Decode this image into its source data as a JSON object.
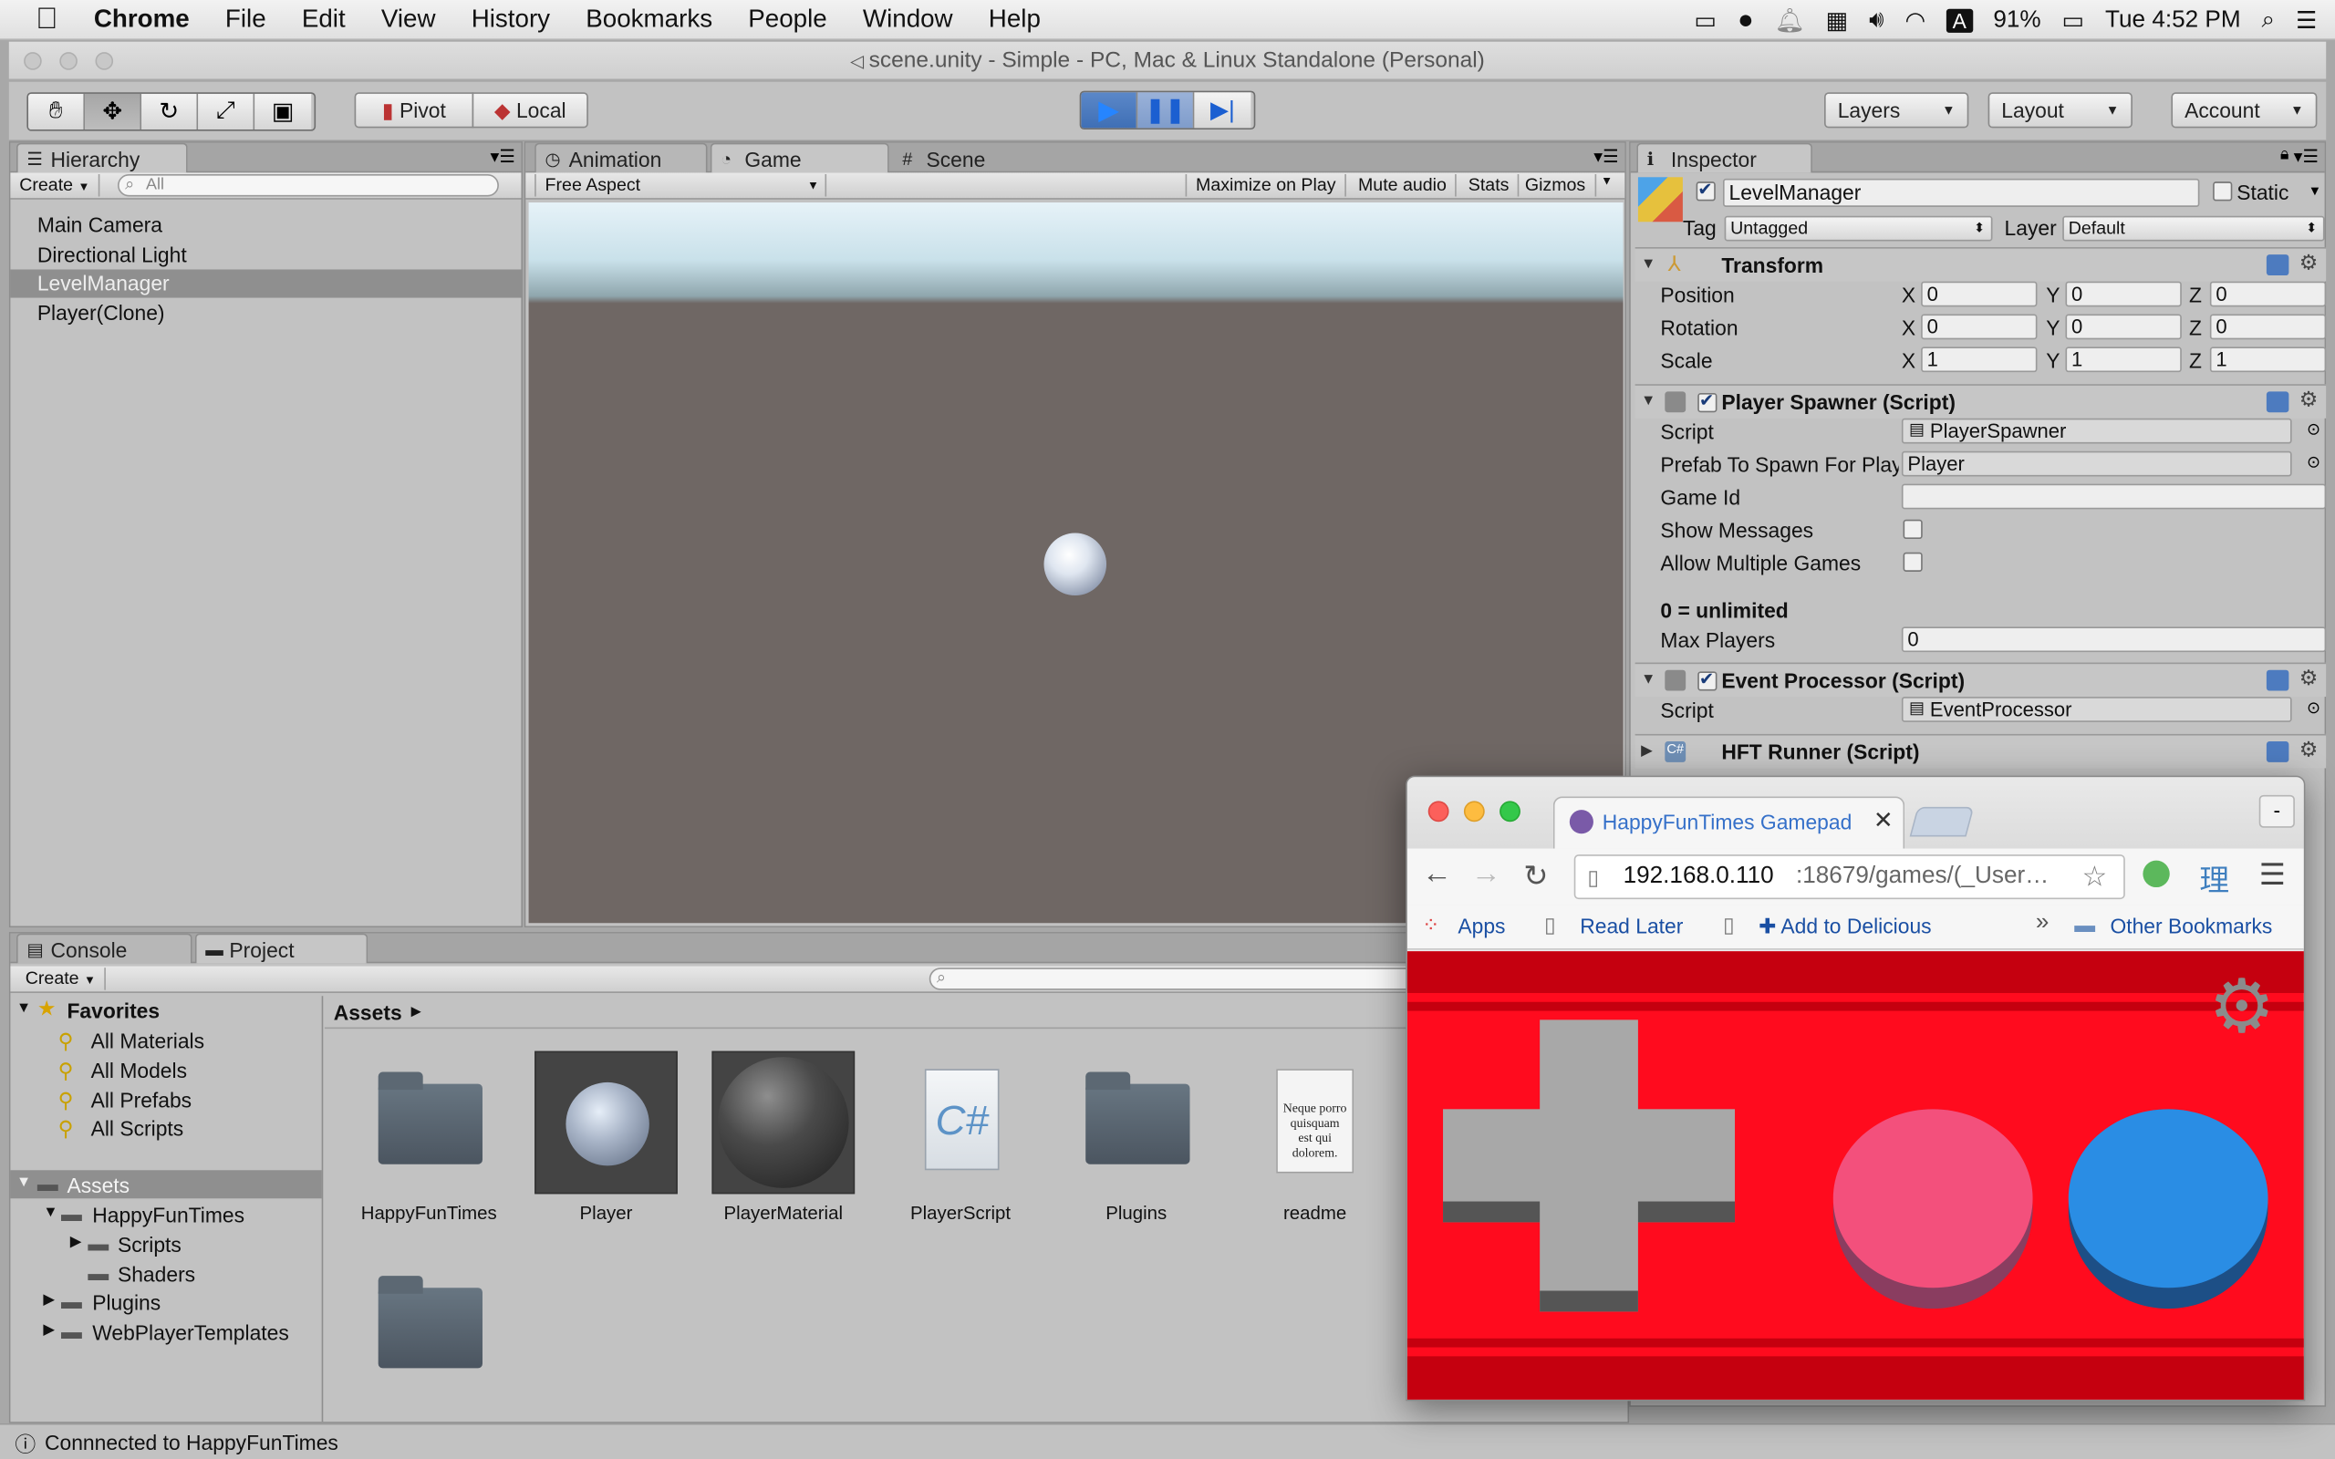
{
  "menubar": {
    "apple": "",
    "app": "Chrome",
    "items": [
      "File",
      "Edit",
      "View",
      "History",
      "Bookmarks",
      "People",
      "Window",
      "Help"
    ],
    "battery": "91%",
    "clock": "Tue 4:52 PM",
    "input_source": "A"
  },
  "window": {
    "title": "scene.unity - Simple - PC, Mac & Linux Standalone (Personal)"
  },
  "toolbar": {
    "pivot": "Pivot",
    "local": "Local",
    "layers": "Layers",
    "layout": "Layout",
    "account": "Account"
  },
  "hierarchy": {
    "tab": "Hierarchy",
    "create": "Create",
    "search_placeholder": "All",
    "items": [
      "Main Camera",
      "Directional Light",
      "LevelManager",
      "Player(Clone)"
    ],
    "selected_index": 2
  },
  "game_view": {
    "tabs": [
      "Animation",
      "Game",
      "Scene"
    ],
    "active_tab": "Game",
    "aspect": "Free Aspect",
    "buttons": [
      "Maximize on Play",
      "Mute audio",
      "Stats",
      "Gizmos"
    ]
  },
  "inspector": {
    "tab": "Inspector",
    "object_name": "LevelManager",
    "static_label": "Static",
    "tag_label": "Tag",
    "tag_value": "Untagged",
    "layer_label": "Layer",
    "layer_value": "Default",
    "transform": {
      "title": "Transform",
      "rows": [
        {
          "label": "Position",
          "x": "0",
          "y": "0",
          "z": "0"
        },
        {
          "label": "Rotation",
          "x": "0",
          "y": "0",
          "z": "0"
        },
        {
          "label": "Scale",
          "x": "1",
          "y": "1",
          "z": "1"
        }
      ]
    },
    "player_spawner": {
      "title": "Player Spawner (Script)",
      "script_label": "Script",
      "script_value": "PlayerSpawner",
      "prefab_label": "Prefab To Spawn For Play",
      "prefab_value": "Player",
      "game_id_label": "Game Id",
      "game_id_value": "",
      "show_messages_label": "Show Messages",
      "show_messages": false,
      "allow_multiple_label": "Allow Multiple Games",
      "allow_multiple": false,
      "note": "0 = unlimited",
      "max_players_label": "Max Players",
      "max_players_value": "0"
    },
    "event_processor": {
      "title": "Event Processor (Script)",
      "script_label": "Script",
      "script_value": "EventProcessor"
    },
    "hft_runner": {
      "title": "HFT Runner (Script)"
    }
  },
  "bottom_tabs": [
    "Console",
    "Project"
  ],
  "project": {
    "create": "Create",
    "favorites_label": "Favorites",
    "favorites": [
      "All Materials",
      "All Models",
      "All Prefabs",
      "All Scripts"
    ],
    "assets_label": "Assets",
    "tree": [
      "HappyFunTimes",
      "Scripts",
      "Shaders",
      "Plugins",
      "WebPlayerTemplates"
    ],
    "breadcrumb": "Assets",
    "assets": [
      {
        "name": "HappyFunTimes",
        "kind": "folder"
      },
      {
        "name": "Player",
        "kind": "prefab"
      },
      {
        "name": "PlayerMaterial",
        "kind": "material"
      },
      {
        "name": "PlayerScript",
        "kind": "csharp"
      },
      {
        "name": "Plugins",
        "kind": "folder"
      },
      {
        "name": "readme",
        "kind": "text"
      },
      {
        "name": "",
        "kind": "folder"
      }
    ],
    "readme_preview": "Neque porro quisquam est qui dolorem."
  },
  "status": {
    "text": "Connnected to HappyFunTimes"
  },
  "chrome": {
    "tab_title": "HappyFunTimes Gamepad",
    "url_host": "192.168.0.110",
    "url_rest": ":18679/games/(_User…",
    "bookmarks": [
      "Apps",
      "Read Later",
      "Add to Delicious"
    ],
    "other_bookmarks": "Other Bookmarks",
    "min_button": "-",
    "colors": {
      "pad_bg": "#ff0b1e",
      "pad_dark": "#c5000f",
      "dpad": "#a8a8a8",
      "button_a": "#f3507c",
      "button_b": "#2a8de4"
    }
  },
  "colors": {
    "unity_panel": "#c2c2c2",
    "selection": "#8f8f8f",
    "game_ground": "#6f6764"
  }
}
